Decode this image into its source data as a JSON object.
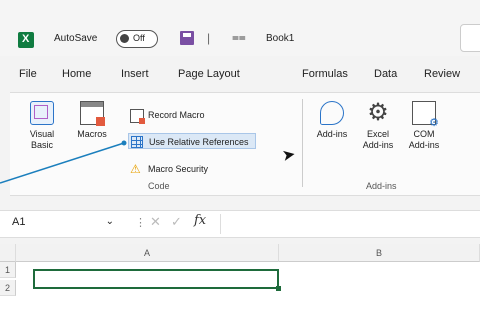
{
  "titlebar": {
    "autosave_label": "AutoSave",
    "toggle_state": "Off",
    "book_title": "Book1"
  },
  "tabs": [
    "File",
    "Home",
    "Insert",
    "Page Layout",
    "Formulas",
    "Data",
    "Review"
  ],
  "ribbon": {
    "code_group": {
      "label": "Code",
      "visual_basic": "Visual Basic",
      "macros": "Macros",
      "record_macro": "Record Macro",
      "use_relative_references": "Use Relative References",
      "macro_security": "Macro Security"
    },
    "addins_group": {
      "label": "Add-ins",
      "addins": "Add-ins",
      "excel_addins": "Excel Add-ins",
      "com_addins": "COM Add-ins"
    }
  },
  "formula_bar": {
    "name_box": "A1",
    "fx": "fx",
    "value": ""
  },
  "grid": {
    "columns": [
      "A",
      "B"
    ],
    "rows": [
      "1",
      "2"
    ]
  },
  "colors": {
    "excel_green": "#107c41",
    "accent_blue": "#2b74c8",
    "selection_green": "#1e6b3b",
    "callout_blue": "#1b7fbd"
  }
}
